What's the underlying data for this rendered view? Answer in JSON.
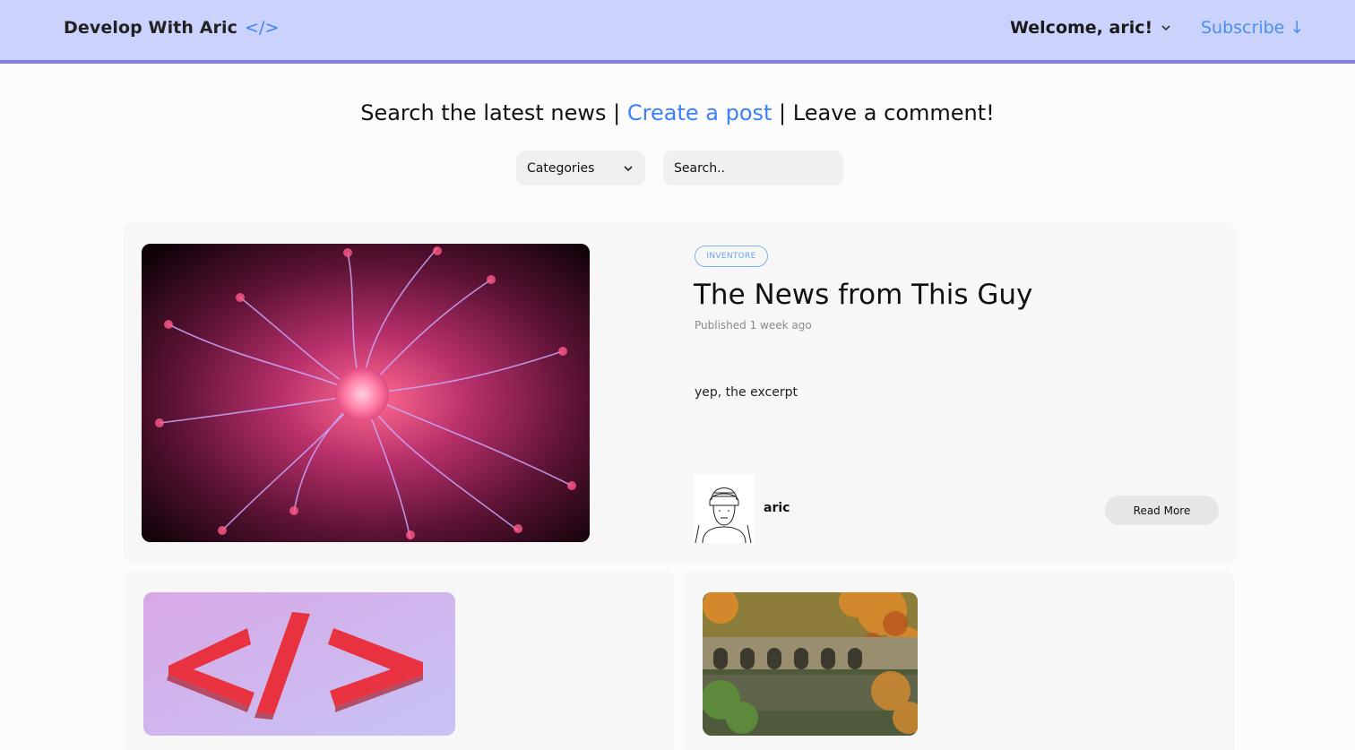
{
  "header": {
    "brand": "Develop With Aric",
    "brand_code": "</>",
    "welcome": "Welcome, aric!",
    "subscribe": "Subscribe ↓"
  },
  "tagline": {
    "part1": "Search the latest news",
    "sep1": " | ",
    "link": "Create a post",
    "sep2": " | ",
    "part3": "Leave a comment!"
  },
  "filters": {
    "categories_label": "Categories",
    "search_placeholder": "Search.."
  },
  "featured_post": {
    "category": "INVENTORE",
    "title": "The News from This Guy",
    "published": "Published 1 week ago",
    "excerpt": "yep, the excerpt",
    "author": "aric",
    "read_more": "Read More"
  },
  "colors": {
    "header_bg": "#cbd3fc",
    "header_border": "#7b80e2",
    "accent": "#3b82f6"
  }
}
